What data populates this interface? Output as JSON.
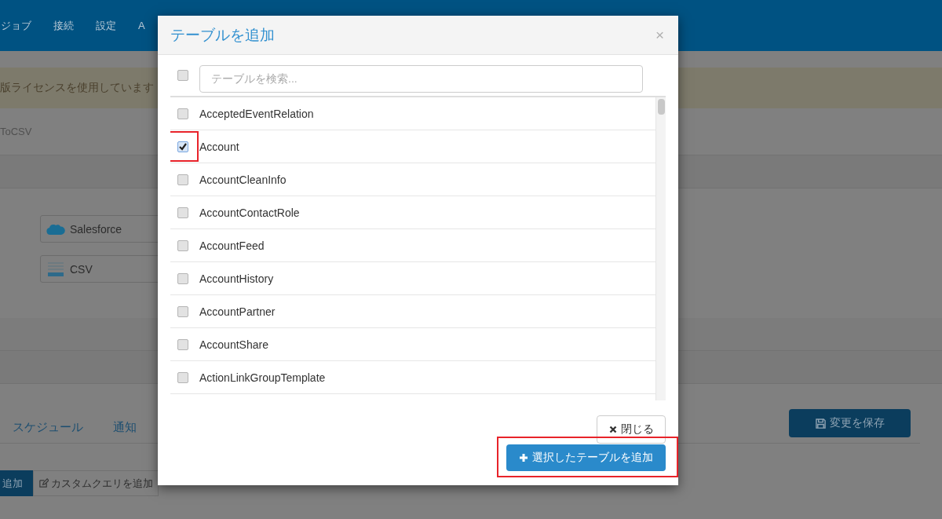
{
  "navbar": {
    "items": [
      "ジョブ",
      "接続",
      "設定",
      "A"
    ]
  },
  "alert": {
    "text": "版ライセンスを使用しています"
  },
  "job_title": "ToCSV",
  "connections": [
    {
      "kind": "salesforce",
      "label": "Salesforce"
    },
    {
      "kind": "csv",
      "label": "CSV"
    }
  ],
  "tabs": [
    "スケジュール",
    "通知"
  ],
  "save_button": "変更を保存",
  "toolbar": [
    {
      "label": "追加",
      "primary": true
    },
    {
      "label": "カスタムクエリを追加",
      "primary": false
    }
  ],
  "modal": {
    "title": "テーブルを追加",
    "close": "×",
    "select_all": {
      "checked": false
    },
    "search_placeholder": "テーブルを検索...",
    "rows": [
      {
        "name": "AcceptedEventRelation",
        "checked": false,
        "highlighted": false
      },
      {
        "name": "Account",
        "checked": true,
        "highlighted": true
      },
      {
        "name": "AccountCleanInfo",
        "checked": false,
        "highlighted": false
      },
      {
        "name": "AccountContactRole",
        "checked": false,
        "highlighted": false
      },
      {
        "name": "AccountFeed",
        "checked": false,
        "highlighted": false
      },
      {
        "name": "AccountHistory",
        "checked": false,
        "highlighted": false
      },
      {
        "name": "AccountPartner",
        "checked": false,
        "highlighted": false
      },
      {
        "name": "AccountShare",
        "checked": false,
        "highlighted": false
      },
      {
        "name": "ActionLinkGroupTemplate",
        "checked": false,
        "highlighted": false
      }
    ],
    "close_button": "閉じる",
    "add_button": {
      "label": "選択したテーブルを追加",
      "highlighted": true
    }
  }
}
